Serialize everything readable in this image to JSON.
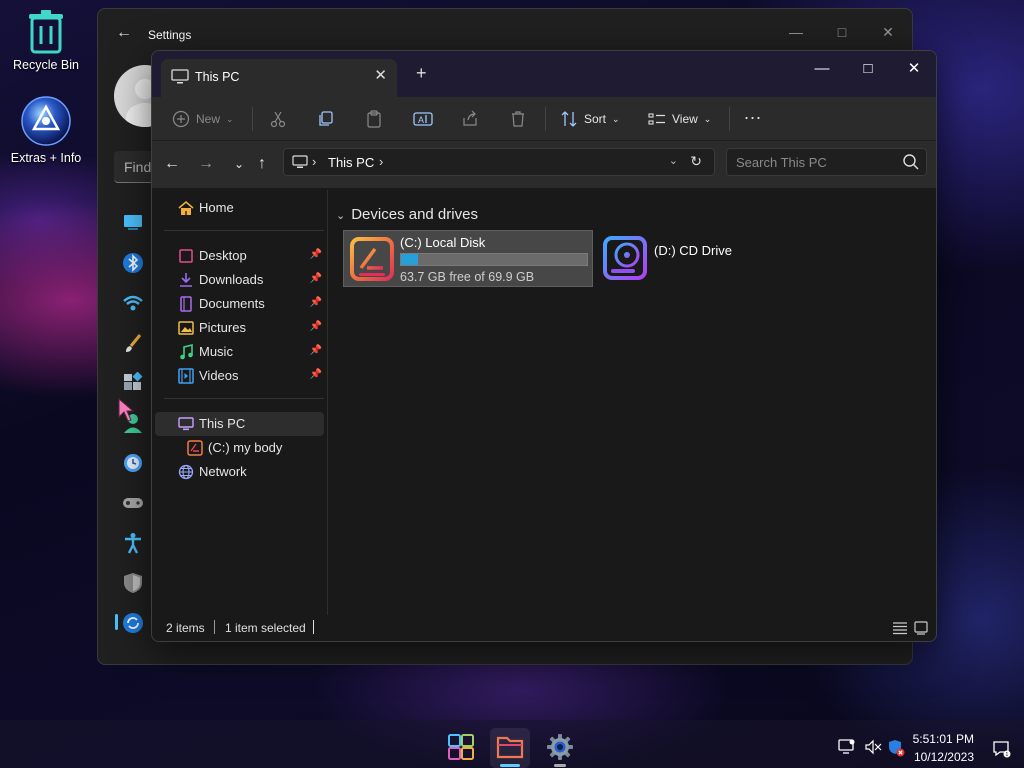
{
  "desktop": {
    "icons": [
      {
        "label": "Recycle Bin",
        "icon": "recycle-bin-icon"
      },
      {
        "label": "Extras + Info",
        "icon": "extras-info-icon"
      }
    ]
  },
  "settings": {
    "title": "Settings",
    "search_placeholder": "Find",
    "sidebar_icons": [
      "system-icon",
      "bluetooth-icon",
      "network-icon",
      "personalization-icon",
      "apps-icon",
      "accounts-icon",
      "time-language-icon",
      "gaming-icon",
      "accessibility-icon",
      "privacy-security-icon",
      "windows-update-icon"
    ]
  },
  "explorer": {
    "tab_title": "This PC",
    "toolbar": {
      "new_label": "New",
      "sort_label": "Sort",
      "view_label": "View",
      "more_label": "..."
    },
    "address": {
      "crumbs": [
        "This PC"
      ],
      "search_placeholder": "Search This PC"
    },
    "nav_pane": {
      "home": "Home",
      "pinned": [
        {
          "label": "Desktop",
          "icon": "desktop-folder-icon",
          "color": "#e04f8a"
        },
        {
          "label": "Downloads",
          "icon": "downloads-folder-icon",
          "color": "#9b6cf0"
        },
        {
          "label": "Documents",
          "icon": "documents-folder-icon",
          "color": "#a86cf0"
        },
        {
          "label": "Pictures",
          "icon": "pictures-folder-icon",
          "color": "#f0c040"
        },
        {
          "label": "Music",
          "icon": "music-folder-icon",
          "color": "#40d080"
        },
        {
          "label": "Videos",
          "icon": "videos-folder-icon",
          "color": "#40a0f0"
        }
      ],
      "this_pc": "This PC",
      "drive_c": "(C:) my body",
      "network": "Network"
    },
    "content": {
      "group_header": "Devices and drives",
      "drives": [
        {
          "name": "(C:) Local Disk",
          "free_text": "63.7 GB free of 69.9 GB",
          "used_fraction": 0.089
        },
        {
          "name": "(D:) CD Drive"
        }
      ]
    },
    "status": {
      "items": "2 items",
      "selected": "1 item selected"
    },
    "colors": {
      "accent": "#26a0da",
      "tab_bar": "#1f1b33"
    }
  },
  "taskbar": {
    "apps": [
      "start-icon",
      "file-explorer-icon",
      "settings-gear-icon"
    ],
    "clock": {
      "time": "5:51:01 PM",
      "date": "10/12/2023"
    }
  }
}
